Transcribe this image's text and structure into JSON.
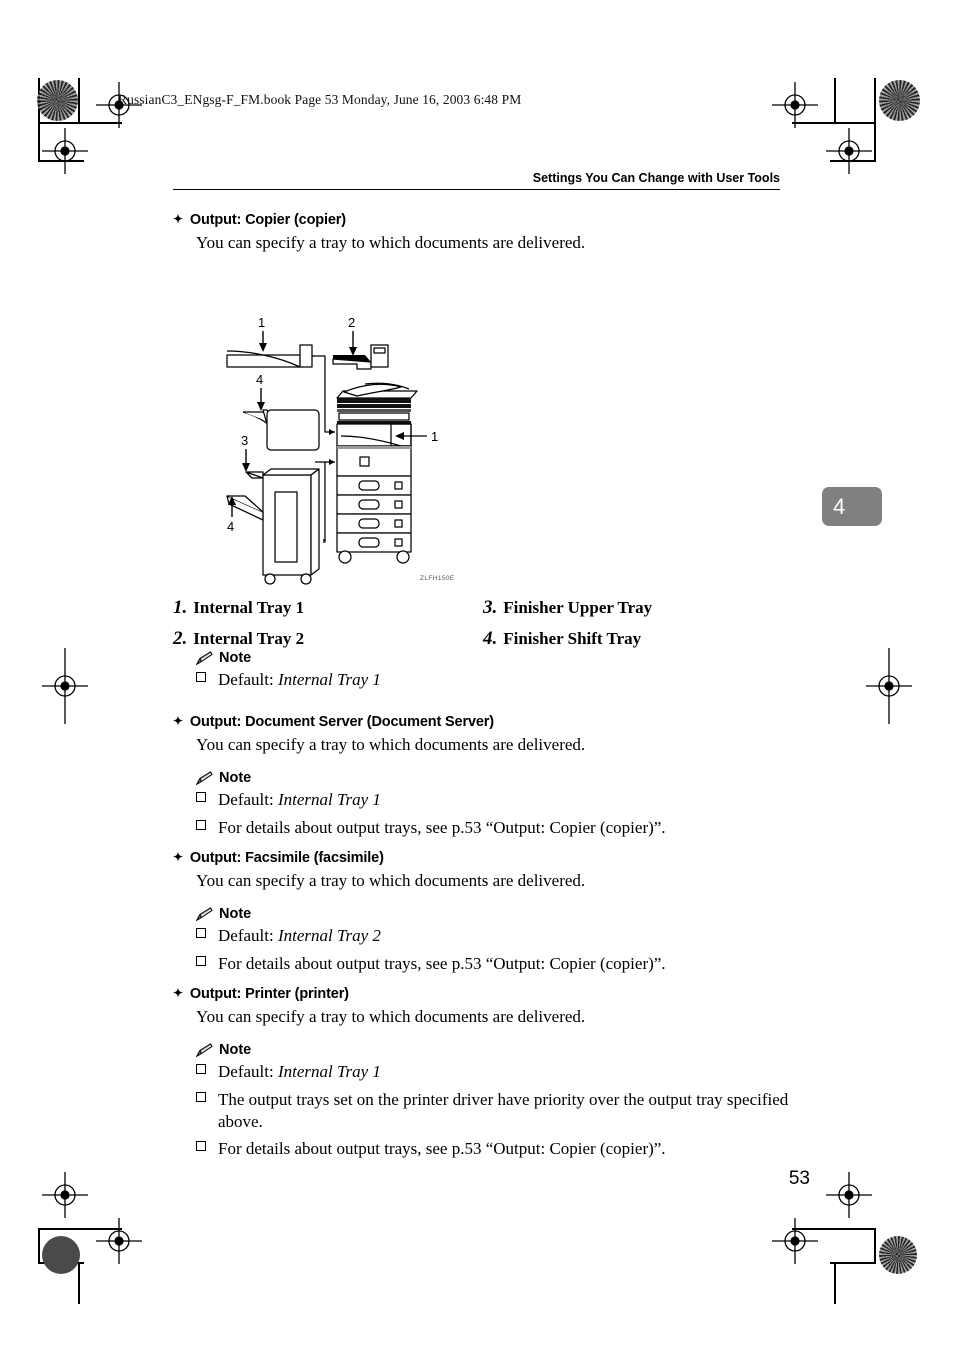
{
  "print_header": "RussianC3_ENgsg-F_FM.book  Page 53  Monday, June 16, 2003  6:48 PM",
  "running_head": "Settings You Can Change with User Tools",
  "chapter_tab": "4",
  "page_number": "53",
  "figure": {
    "code": "ZLFH150E",
    "callouts": [
      "1",
      "2",
      "3",
      "4",
      "1"
    ]
  },
  "legend": {
    "items": [
      {
        "num": "1.",
        "label": "Internal Tray 1"
      },
      {
        "num": "3.",
        "label": "Finisher Upper Tray"
      },
      {
        "num": "2.",
        "label": "Internal Tray 2"
      },
      {
        "num": "4.",
        "label": "Finisher Shift Tray"
      }
    ]
  },
  "note_label": "Note",
  "sections": [
    {
      "heading": "Output: Copier (copier)",
      "body": "You can specify a tray to which documents are delivered.",
      "notes": [
        {
          "pre": "Default: ",
          "italic": "Internal Tray 1",
          "post": ""
        }
      ]
    },
    {
      "heading": "Output: Document Server (Document Server)",
      "body": "You can specify a tray to which documents are delivered.",
      "notes": [
        {
          "pre": "Default: ",
          "italic": "Internal Tray 1",
          "post": ""
        },
        {
          "pre": "For details about output trays, see p.53 “Output: Copier (copier)”.",
          "italic": "",
          "post": ""
        }
      ]
    },
    {
      "heading": "Output: Facsimile (facsimile)",
      "body": "You can specify a tray to which documents are delivered.",
      "notes": [
        {
          "pre": "Default: ",
          "italic": "Internal Tray 2",
          "post": ""
        },
        {
          "pre": "For details about output trays, see p.53 “Output: Copier (copier)”.",
          "italic": "",
          "post": ""
        }
      ]
    },
    {
      "heading": "Output: Printer (printer)",
      "body": "You can specify a tray to which documents are delivered.",
      "notes": [
        {
          "pre": "Default: ",
          "italic": "Internal Tray 1",
          "post": ""
        },
        {
          "pre": "The output trays set on the printer driver have priority over the output tray specified above.",
          "italic": "",
          "post": ""
        },
        {
          "pre": "For details about output trays, see p.53 “Output: Copier (copier)”.",
          "italic": "",
          "post": ""
        }
      ]
    }
  ]
}
